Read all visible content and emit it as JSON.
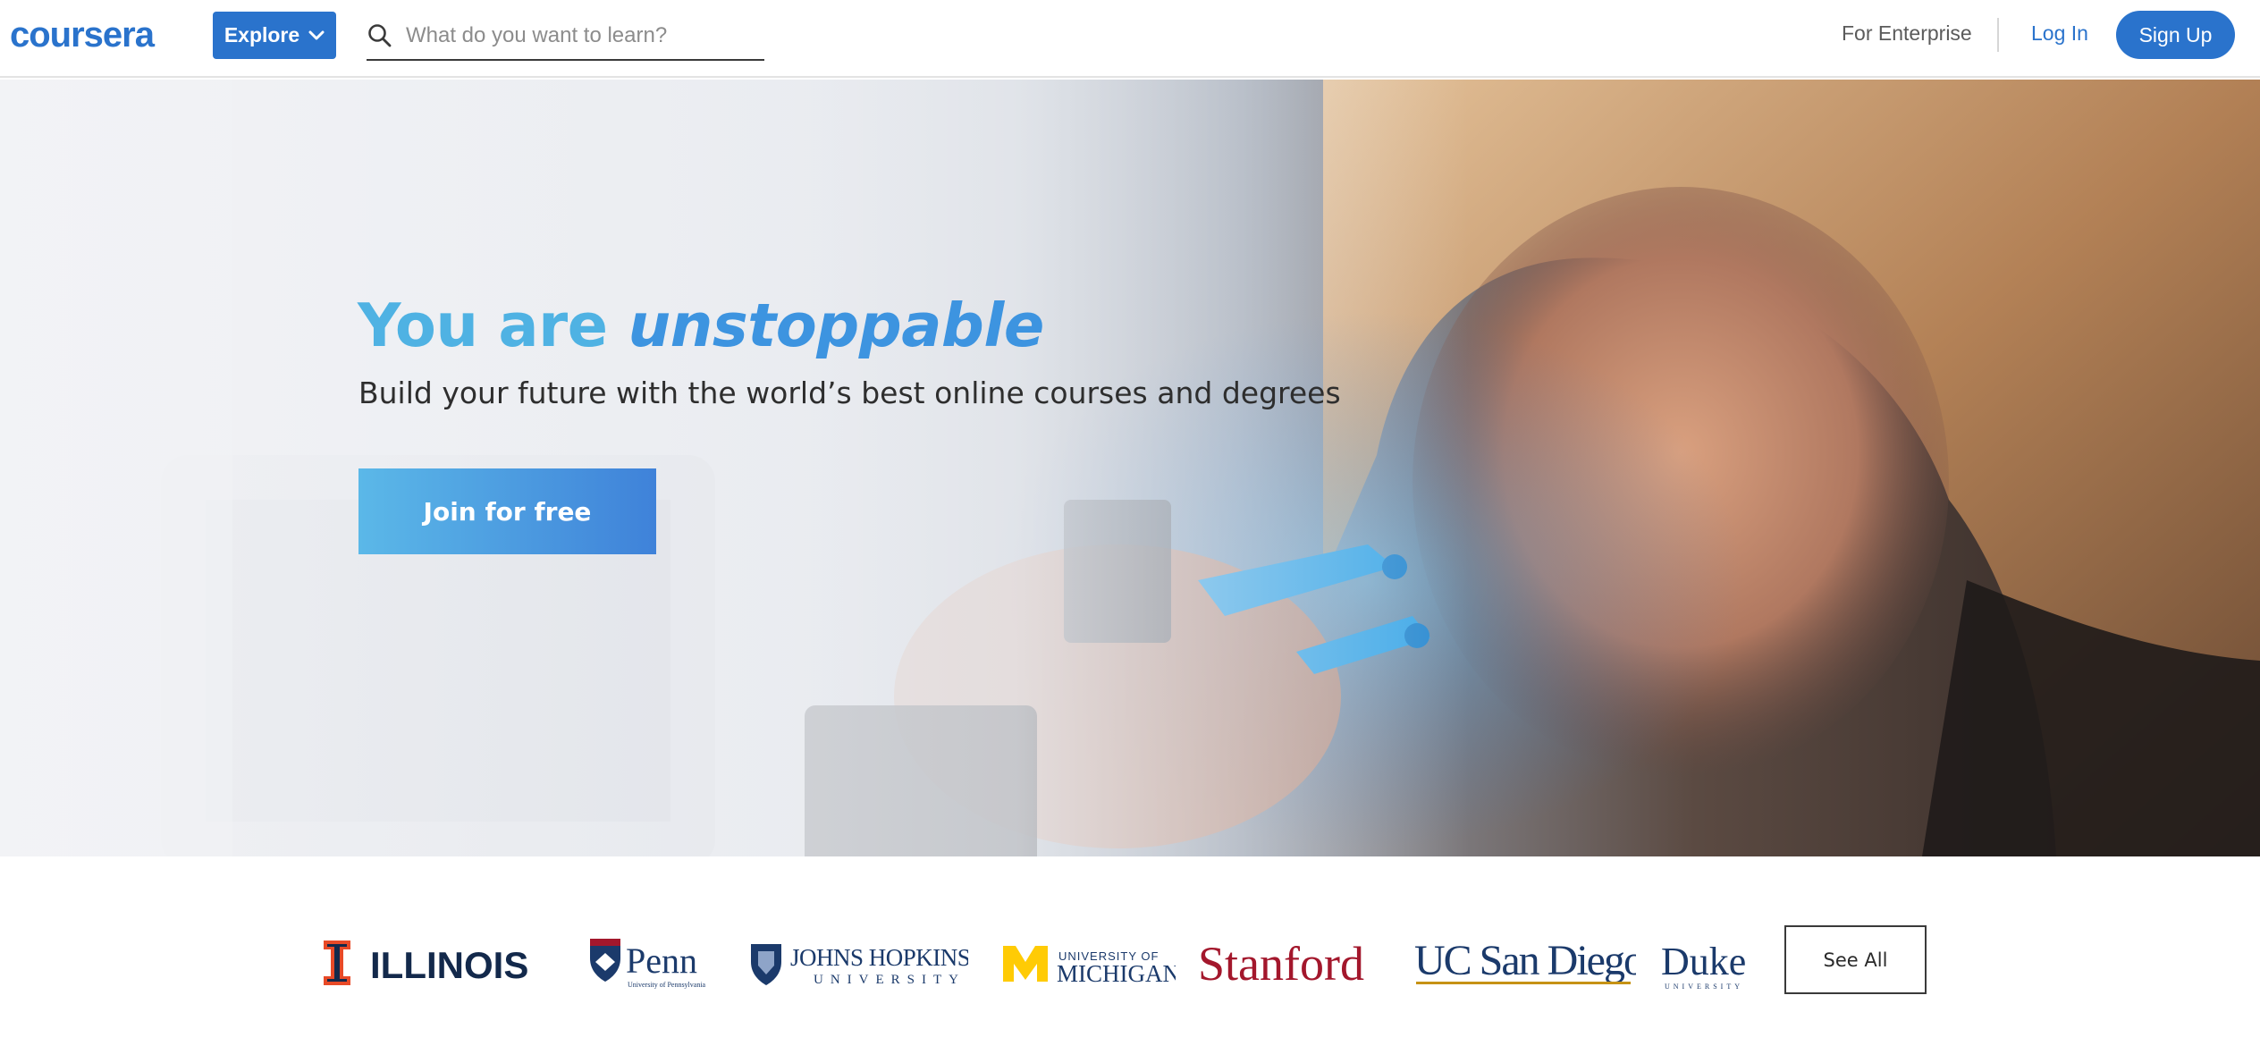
{
  "header": {
    "logo_text": "coursera",
    "explore_label": "Explore",
    "search_placeholder": "What do you want to learn?",
    "enterprise_label": "For Enterprise",
    "login_label": "Log In",
    "signup_label": "Sign Up"
  },
  "hero": {
    "title_plain": "You are ",
    "title_emphasis": "unstoppable",
    "subtitle": "Build your future with the world’s best online courses and degrees",
    "cta_label": "Join for free"
  },
  "partners": {
    "items": [
      {
        "name": "ILLINOIS",
        "icon": "illinois-logo"
      },
      {
        "name": "Penn",
        "tagline": "University of Pennsylvania",
        "icon": "penn-logo"
      },
      {
        "name": "JOHNS HOPKINS",
        "tagline": "UNIVERSITY",
        "icon": "johns-hopkins-logo"
      },
      {
        "name": "MICHIGAN",
        "tagline": "UNIVERSITY OF",
        "icon": "michigan-logo"
      },
      {
        "name": "Stanford",
        "icon": "stanford-logo"
      },
      {
        "name": "UC San Diego",
        "icon": "ucsd-logo"
      },
      {
        "name": "Duke",
        "tagline": "UNIVERSITY",
        "icon": "duke-logo"
      }
    ],
    "see_all_label": "See All"
  },
  "colors": {
    "brand_blue": "#2a73cc",
    "hero_title": "#4fb2e3",
    "hero_title_emphasis": "#3d94e0",
    "illinois_orange": "#e84a27",
    "illinois_navy": "#13294b",
    "stanford_red": "#a3172c",
    "michigan_maize": "#ffcb05",
    "navy": "#1b3a6b"
  }
}
